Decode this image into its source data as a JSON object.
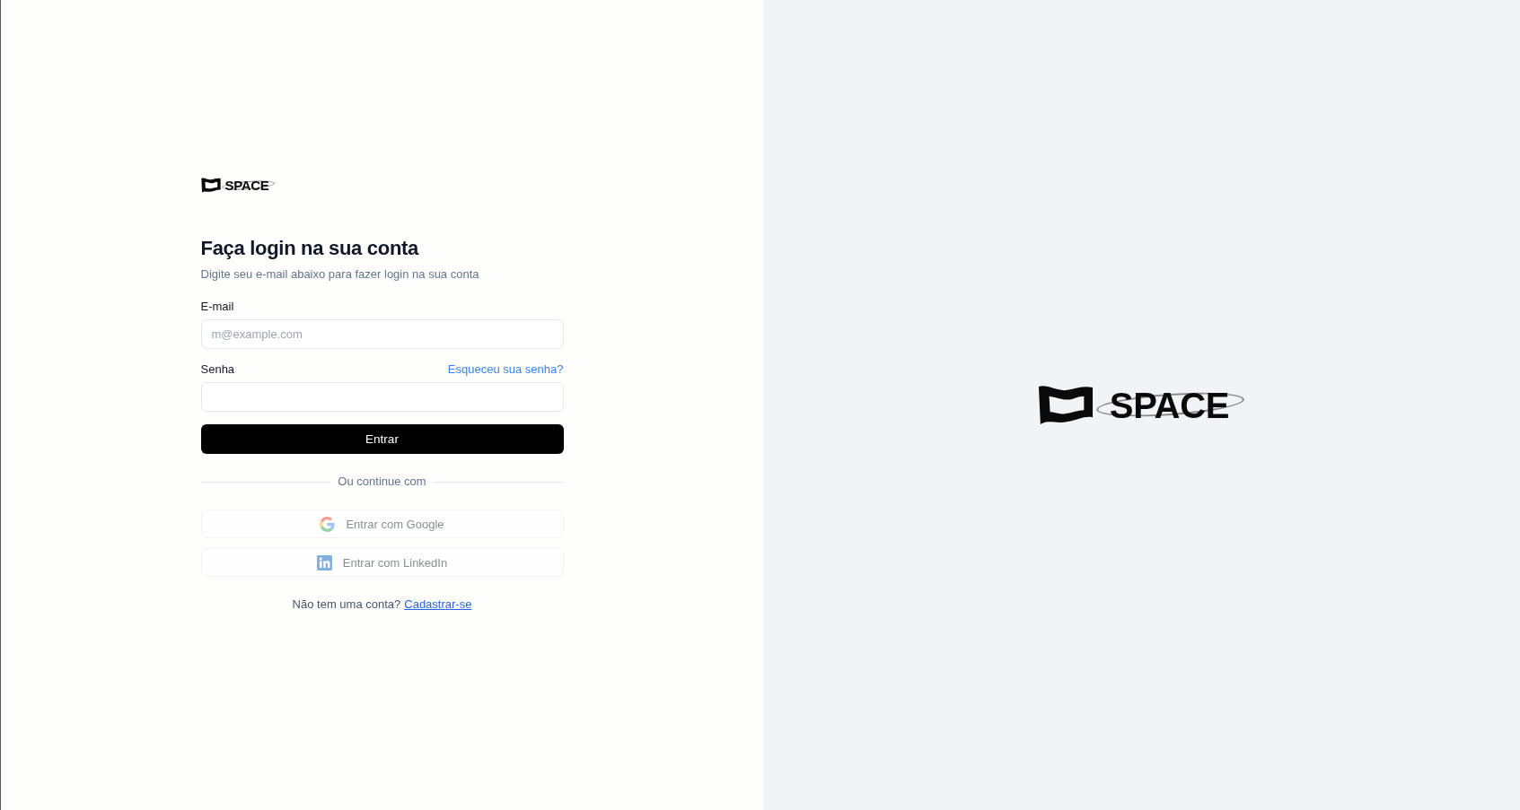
{
  "header_logo": {
    "text": "SPACE"
  },
  "login": {
    "title": "Faça login na sua conta",
    "subtitle": "Digite seu e-mail abaixo para fazer login na sua conta",
    "fields": [
      {
        "label": "E-mail",
        "placeholder": "m@example.com"
      },
      {
        "label": "Senha",
        "link": "Esqueceu sua senha?"
      }
    ],
    "submit": "Entrar",
    "divider": "Ou continue com",
    "social_buttons": [
      {
        "kind": "google",
        "label": "Entrar com Google",
        "disabled": true
      },
      {
        "kind": "linkedin",
        "label": "Entrar com LinkedIn",
        "disabled": true
      }
    ],
    "signup": {
      "text": "Não tem uma conta?",
      "link": "Cadastrar-se"
    }
  },
  "side_panel": {
    "logo_text": "SPACE"
  }
}
